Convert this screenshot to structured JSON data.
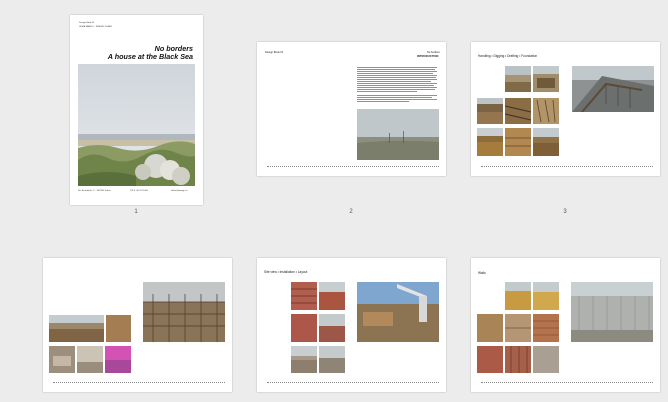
{
  "cover": {
    "meta_line1": "Design Book 01",
    "meta_line2": "LESIA SANDU – SERGIU VLASE",
    "title_line1": "No borders",
    "title_line2": "A house at the Black Sea",
    "footer_left": "Str. Ecoului Nr. 2 – 907055 Sulina",
    "footer_mid": "T/F 0 +40 741 000",
    "footer_right": "office@design.ro"
  },
  "page2": {
    "heading": "INTRODUCTION",
    "header_left": "Design Book 01",
    "header_right": "No borders"
  },
  "page3": {
    "section": "Handling • Digging • Drafting • Foundation"
  },
  "page5": {
    "section": "Site view  •  Installation  •  Layout"
  },
  "page6": {
    "section": "Walls"
  },
  "page_numbers": [
    "1",
    "2",
    "3"
  ]
}
